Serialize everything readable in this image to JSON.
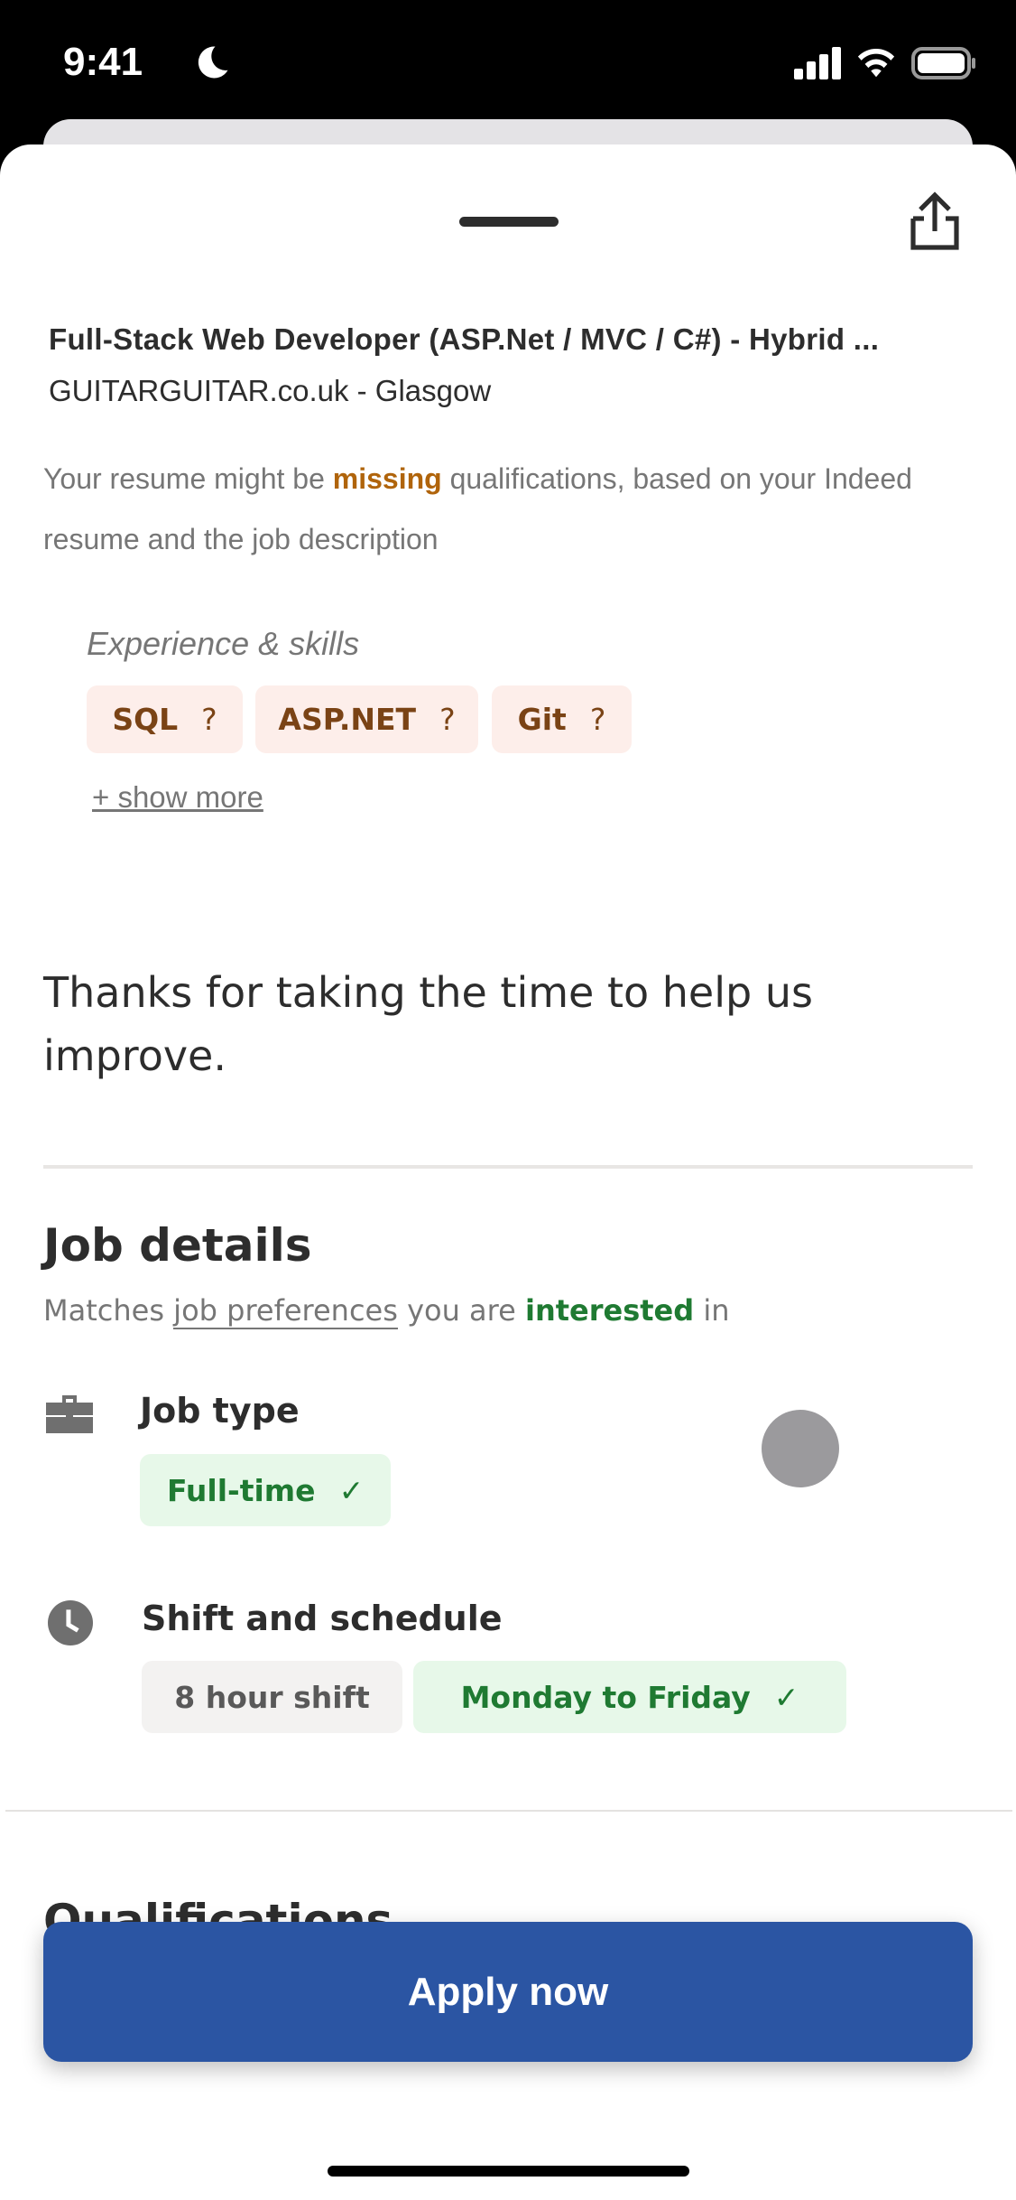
{
  "status_bar": {
    "time": "9:41",
    "icons": [
      "moon-icon",
      "signal-icon",
      "wifi-icon",
      "battery-icon"
    ]
  },
  "header": {
    "share_icon": "share-icon"
  },
  "job": {
    "title": "Full-Stack Web Developer (ASP.Net / MVC / C#) - Hybrid ...",
    "company_location": "GUITARGUITAR.co.uk - Glasgow"
  },
  "qualification_notice": {
    "prefix": "Your resume might be ",
    "highlight": "missing",
    "suffix": " qualifications, based on your Indeed resume and the job description"
  },
  "skills": {
    "heading": "Experience & skills",
    "items": [
      {
        "label": "SQL",
        "icon": "?"
      },
      {
        "label": "ASP.NET",
        "icon": "?"
      },
      {
        "label": "Git",
        "icon": "?"
      }
    ],
    "show_more": "+ show more"
  },
  "feedback": {
    "thanks": "Thanks for taking the time to help us improve."
  },
  "job_details": {
    "heading": "Job details",
    "matches_prefix": "Matches ",
    "matches_link": "job preferences",
    "matches_mid": " you are ",
    "matches_highlight": "interested",
    "matches_suffix": " in",
    "job_type": {
      "label": "Job type",
      "icon": "briefcase-icon",
      "chips": [
        {
          "label": "Full-time",
          "matched": true,
          "check": "✓"
        }
      ]
    },
    "shift": {
      "label": "Shift and schedule",
      "icon": "clock-icon",
      "chips": [
        {
          "label": "8 hour shift",
          "matched": false
        },
        {
          "label": "Monday to Friday",
          "matched": true,
          "check": "✓"
        }
      ]
    }
  },
  "qualifications": {
    "heading": "Qualifications"
  },
  "apply_button": {
    "label": "Apply now"
  },
  "colors": {
    "primary": "#2b55a3",
    "missing": "#b0640b",
    "match": "#1f7a32",
    "skill_chip_bg": "#fdeeea",
    "match_chip_bg": "#e7f8e9"
  }
}
